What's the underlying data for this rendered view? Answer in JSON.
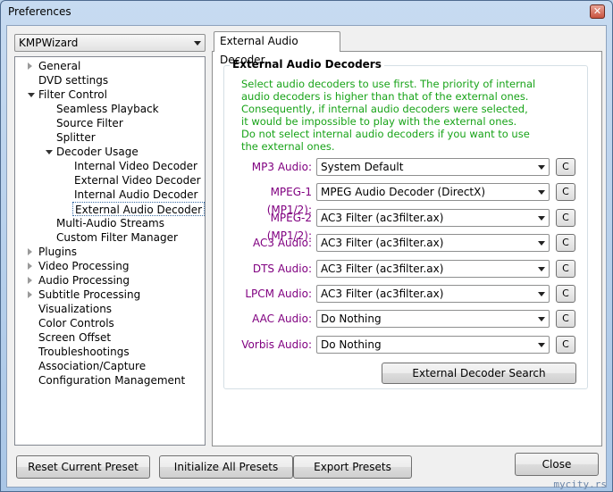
{
  "window": {
    "title": "Preferences",
    "close_glyph": "✕"
  },
  "preset": {
    "value": "KMPWizard"
  },
  "tree": [
    {
      "label": "General",
      "expander": "collapsed"
    },
    {
      "label": "DVD settings"
    },
    {
      "label": "Filter Control",
      "expander": "expanded"
    },
    {
      "label": "Seamless Playback"
    },
    {
      "label": "Source Filter"
    },
    {
      "label": "Splitter"
    },
    {
      "label": "Decoder Usage",
      "expander": "expanded"
    },
    {
      "label": "Internal Video Decoder"
    },
    {
      "label": "External Video Decoder"
    },
    {
      "label": "Internal Audio Decoder"
    },
    {
      "label": "External Audio Decoder",
      "selected": true
    },
    {
      "label": "Multi-Audio Streams"
    },
    {
      "label": "Custom Filter Manager"
    },
    {
      "label": "Plugins",
      "expander": "collapsed"
    },
    {
      "label": "Video Processing",
      "expander": "collapsed"
    },
    {
      "label": "Audio Processing",
      "expander": "collapsed"
    },
    {
      "label": "Subtitle Processing",
      "expander": "collapsed"
    },
    {
      "label": "Visualizations"
    },
    {
      "label": "Color Controls"
    },
    {
      "label": "Screen Offset"
    },
    {
      "label": "Troubleshootings"
    },
    {
      "label": "Association/Capture"
    },
    {
      "label": "Configuration Management"
    }
  ],
  "tab": {
    "label": "External Audio Decoder"
  },
  "group": {
    "title": "External Audio Decoders",
    "description": [
      "Select audio decoders to use first. The priority of internal",
      "audio decoders is higher than that of the external ones.",
      "Consequently, if internal audio decoders were selected,",
      "it would be impossible to play with the external ones.",
      "Do not select internal audio decoders if you want to use",
      "the external ones."
    ]
  },
  "decoders": [
    {
      "label": "MP3 Audio:",
      "value": "System Default",
      "button": "C"
    },
    {
      "label": "MPEG-1 (MP1/2):",
      "value": "MPEG Audio Decoder (DirectX)",
      "button": "C"
    },
    {
      "label": "MPEG-2 (MP1/2):",
      "value": "AC3 Filter (ac3filter.ax)",
      "button": "C"
    },
    {
      "label": "AC3 Audio:",
      "value": "AC3 Filter (ac3filter.ax)",
      "button": "C"
    },
    {
      "label": "DTS Audio:",
      "value": "AC3 Filter (ac3filter.ax)",
      "button": "C"
    },
    {
      "label": "LPCM Audio:",
      "value": "AC3 Filter (ac3filter.ax)",
      "button": "C"
    },
    {
      "label": "AAC Audio:",
      "value": "Do Nothing",
      "button": "C"
    },
    {
      "label": "Vorbis Audio:",
      "value": "Do Nothing",
      "button": "C"
    }
  ],
  "search_button": "External Decoder Search",
  "footer": {
    "reset": "Reset Current Preset",
    "initialize": "Initialize All Presets",
    "export": "Export Presets",
    "close": "Close"
  },
  "watermark": "mycity.rs",
  "colors": {
    "decoder_label": "#800080",
    "description": "#18a318"
  }
}
